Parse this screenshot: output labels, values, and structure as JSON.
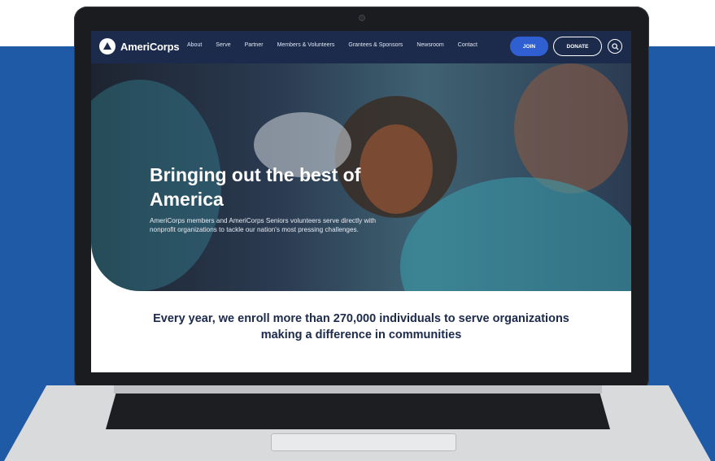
{
  "brand": {
    "name": "AmeriCorps"
  },
  "nav": {
    "items": [
      "About",
      "Serve",
      "Partner",
      "Members & Volunteers",
      "Grantees & Sponsors",
      "Newsroom",
      "Contact"
    ],
    "join_label": "JOIN",
    "donate_label": "DONATE"
  },
  "hero": {
    "title": "Bringing out the best of America",
    "description": "AmeriCorps members and AmeriCorps Seniors volunteers serve directly with nonprofit organizations to tackle our nation's most pressing challenges."
  },
  "tagline": "Every year, we enroll more than 270,000 individuals to serve organizations making a difference in communities",
  "colors": {
    "background_blue": "#1f5aa6",
    "nav_navy": "#1c2a4b",
    "join_blue": "#2f5fd0"
  },
  "icons": {
    "search": "search-icon",
    "logo": "americorps-logo-icon"
  }
}
